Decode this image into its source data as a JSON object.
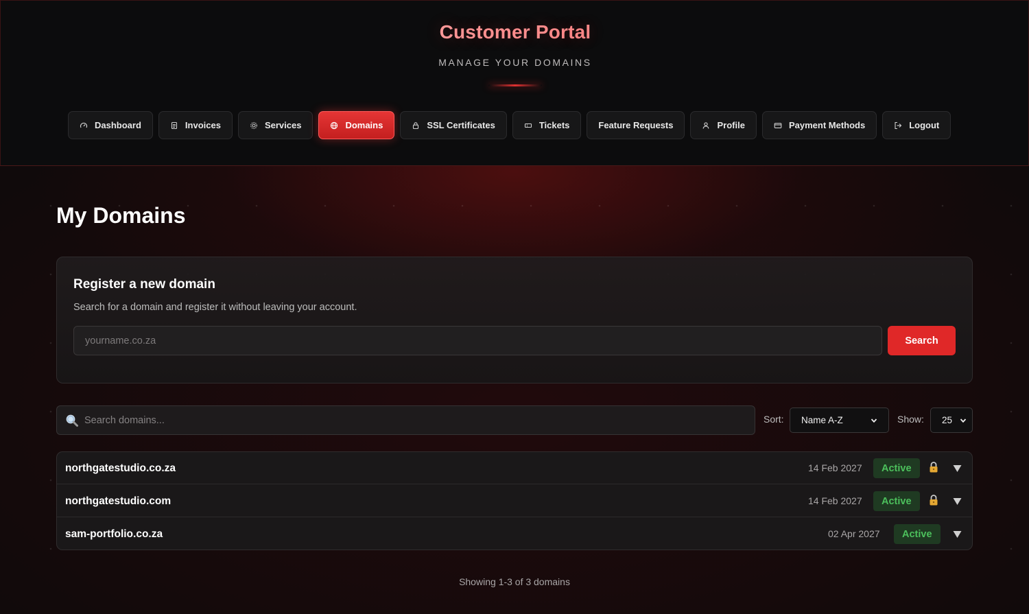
{
  "header": {
    "title": "Customer Portal",
    "subtitle": "MANAGE YOUR DOMAINS"
  },
  "nav": {
    "items": [
      {
        "label": "Dashboard",
        "icon": "gauge-icon",
        "active": false
      },
      {
        "label": "Invoices",
        "icon": "invoice-icon",
        "active": false
      },
      {
        "label": "Services",
        "icon": "gear-icon",
        "active": false
      },
      {
        "label": "Domains",
        "icon": "globe-icon",
        "active": true
      },
      {
        "label": "SSL Certificates",
        "icon": "lock-icon",
        "active": false
      },
      {
        "label": "Tickets",
        "icon": "ticket-icon",
        "active": false
      },
      {
        "label": "Feature Requests",
        "icon": "",
        "active": false
      },
      {
        "label": "Profile",
        "icon": "user-icon",
        "active": false
      },
      {
        "label": "Payment Methods",
        "icon": "credit-card-icon",
        "active": false
      },
      {
        "label": "Logout",
        "icon": "logout-icon",
        "active": false
      }
    ]
  },
  "main": {
    "page_title": "My Domains",
    "register": {
      "title": "Register a new domain",
      "description": "Search for a domain and register it without leaving your account.",
      "input_placeholder": "yourname.co.za",
      "input_value": "",
      "button_label": "Search"
    },
    "filters": {
      "search_placeholder": "Search domains...",
      "search_value": "",
      "sort_label": "Sort:",
      "sort_value": "Name A-Z",
      "show_label": "Show:",
      "show_value": "25"
    },
    "domains": [
      {
        "name": "northgatestudio.co.za",
        "expiry": "14 Feb 2027",
        "status": "Active",
        "locked": true
      },
      {
        "name": "northgatestudio.com",
        "expiry": "14 Feb 2027",
        "status": "Active",
        "locked": true
      },
      {
        "name": "sam-portfolio.co.za",
        "expiry": "02 Apr 2027",
        "status": "Active",
        "locked": false
      }
    ],
    "pagination_summary": "Showing 1-3 of 3 domains"
  },
  "colors": {
    "accent": "#e02828",
    "active_status_text": "#4cc05c",
    "active_status_bg": "#1f3a22",
    "lock": "#e5a833"
  }
}
